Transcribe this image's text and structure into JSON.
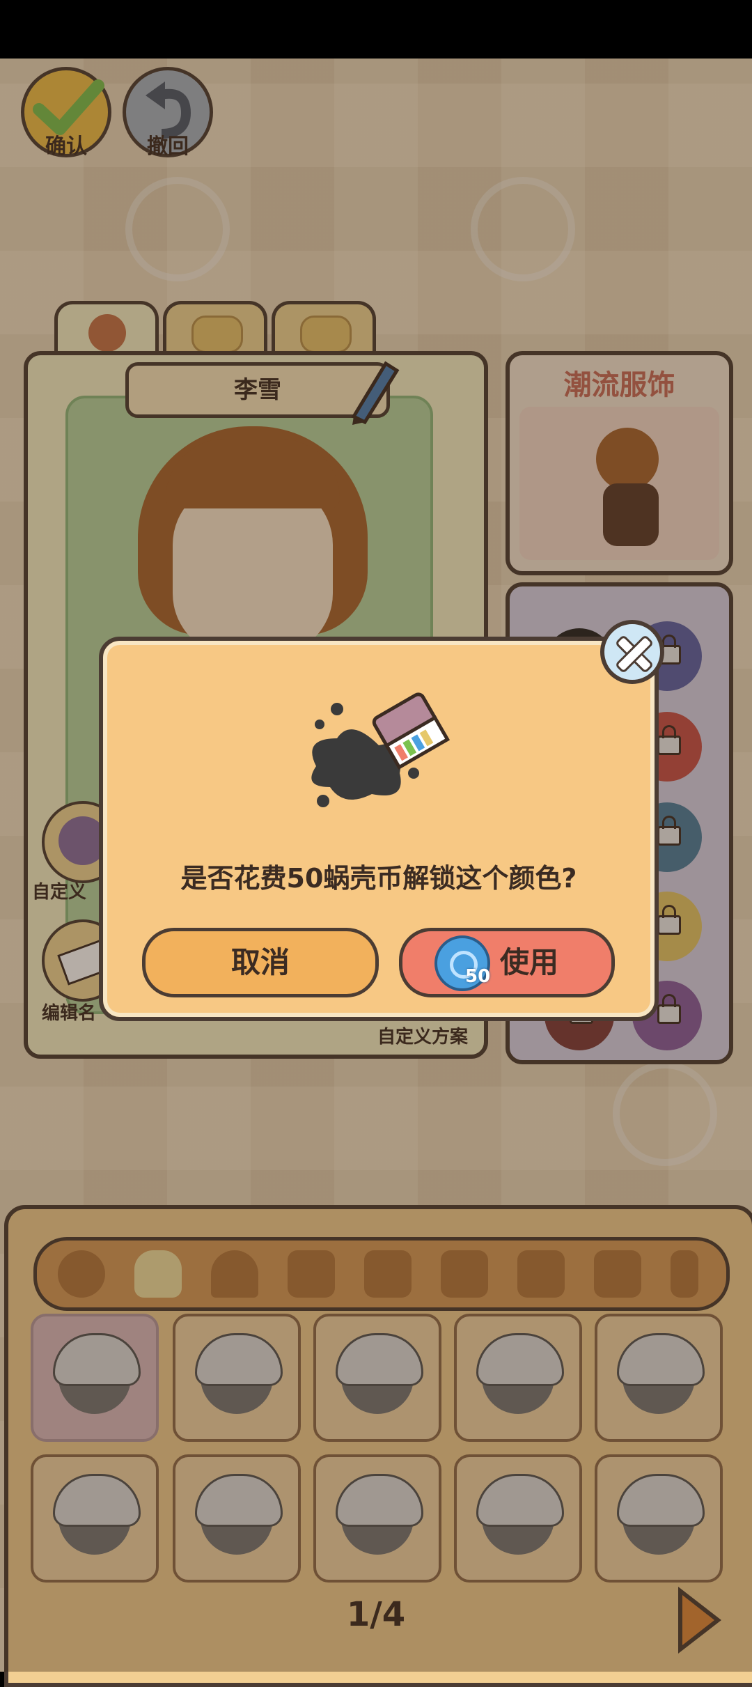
{
  "top_buttons": {
    "confirm_label": "确认",
    "undo_label": "撤回"
  },
  "character": {
    "name": "李雪"
  },
  "right_panel": {
    "title": "潮流服饰"
  },
  "side_buttons": {
    "custom_label_partial": "自定义",
    "edit_name_label_partial": "编辑名",
    "custom_plan_label": "自定义方案"
  },
  "dialog": {
    "question": "是否花费50蜗壳币解锁这个颜色?",
    "cancel_label": "取消",
    "use_label": "使用",
    "cost": "50"
  },
  "bottom": {
    "page_indicator": "1/4"
  },
  "colors": {
    "dialog_bg": "#f7c884",
    "cancel_btn": "#f2b15c",
    "use_btn": "#f07e6a",
    "outline": "#4b3c33"
  },
  "icons": [
    "check-icon",
    "undo-icon",
    "face-tab-icon",
    "cat-tab-icon",
    "dog-tab-icon",
    "pencil-icon",
    "close-icon",
    "paint-icon",
    "coin-icon",
    "lock-icon",
    "next-arrow-icon"
  ]
}
